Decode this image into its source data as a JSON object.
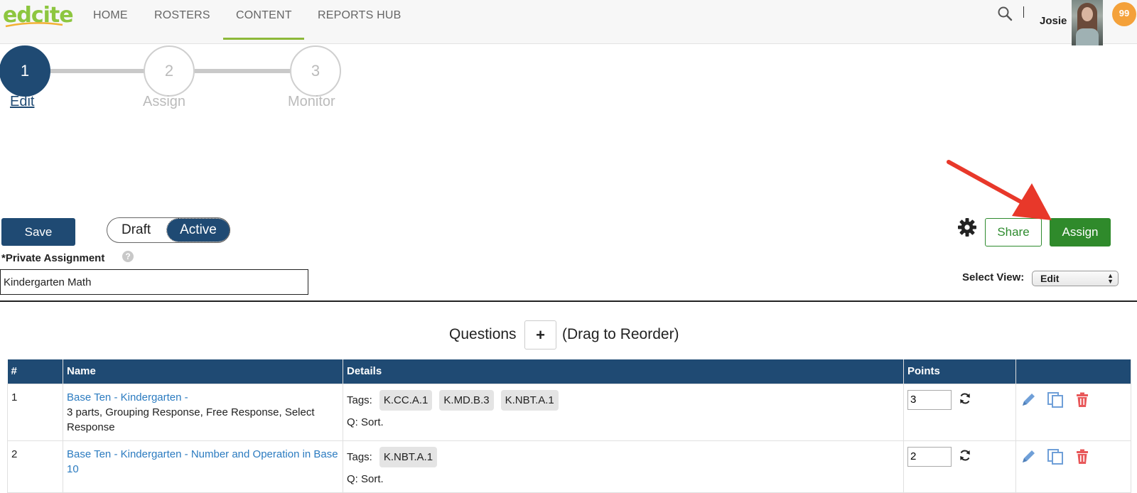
{
  "brand": {
    "logo_text": "edcite"
  },
  "nav": {
    "home": "HOME",
    "rosters": "ROSTERS",
    "content": "CONTENT",
    "reports": "REPORTS HUB"
  },
  "user": {
    "name": "Josie",
    "notifications": "99"
  },
  "stepper": [
    {
      "number": "1",
      "label": "Edit",
      "state": "current"
    },
    {
      "number": "2",
      "label": "Assign",
      "state": "upcoming"
    },
    {
      "number": "3",
      "label": "Monitor",
      "state": "upcoming"
    }
  ],
  "toolbar": {
    "save": "Save",
    "draft": "Draft",
    "active": "Active",
    "share": "Share",
    "assign": "Assign"
  },
  "assignment": {
    "label": "*Private Assignment",
    "help": "?",
    "title_value": "Kindergarten Math"
  },
  "select_view": {
    "label": "Select View:",
    "value": "Edit"
  },
  "questions": {
    "title": "Questions",
    "add": "+",
    "hint": "(Drag to Reorder)"
  },
  "table": {
    "headers": [
      "#",
      "Name",
      "Details",
      "Points",
      ""
    ],
    "rows": [
      {
        "num": "1",
        "name": "Base Ten - Kindergarten -",
        "desc": "3 parts, Grouping Response, Free Response, Select Response",
        "tags_label": "Tags:",
        "tags": [
          "K.CC.A.1",
          "K.MD.B.3",
          "K.NBT.A.1"
        ],
        "question": "Q: Sort.",
        "points": "3"
      },
      {
        "num": "2",
        "name": "Base Ten - Kindergarten - Number and Operation in Base 10",
        "desc": "",
        "tags_label": "Tags:",
        "tags": [
          "K.NBT.A.1"
        ],
        "question": "Q: Sort.",
        "points": "2"
      }
    ]
  },
  "colors": {
    "primary": "#1f4a73",
    "accent_green": "#2f8a2b",
    "brand_green": "#8dc63f",
    "link_blue": "#2b7bc0",
    "delete_red": "#e8585a",
    "arrow_red": "#e8382a"
  }
}
